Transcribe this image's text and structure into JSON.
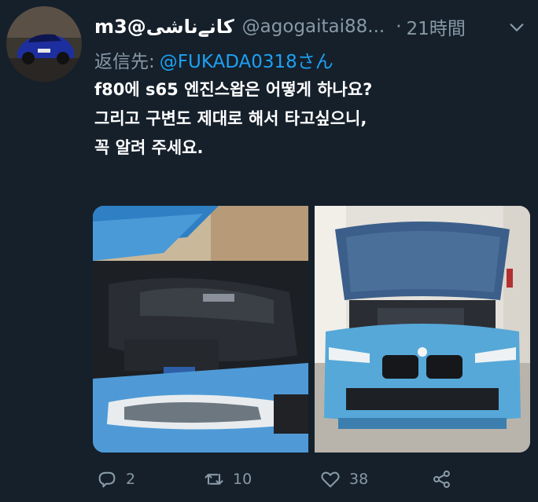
{
  "tweet": {
    "display_name": "m3@كانےناشى",
    "handle": "@agogaitai88...",
    "separator": "·",
    "time": "21時間",
    "reply_label": "返信先:",
    "reply_mention": "@FUKADA0318さん",
    "text_lines": [
      "f80에 s65 엔진스왑은 어떻게 하나요?",
      "그리고 구변도 제대로 해서 타고싶으니,",
      "꼭 알려 주세요."
    ],
    "media": {
      "count": 2,
      "photos": [
        "engine-bay-closeup",
        "car-front-hood-open"
      ]
    },
    "actions": {
      "reply_count": "2",
      "retweet_count": "10",
      "like_count": "38"
    }
  },
  "icons": {
    "menu": "chevron-down-icon",
    "reply": "reply-icon",
    "retweet": "retweet-icon",
    "like": "heart-icon",
    "share": "share-icon"
  },
  "colors": {
    "background": "#15202b",
    "text": "#ffffff",
    "secondary": "#8899a6",
    "link": "#1da1f2"
  }
}
